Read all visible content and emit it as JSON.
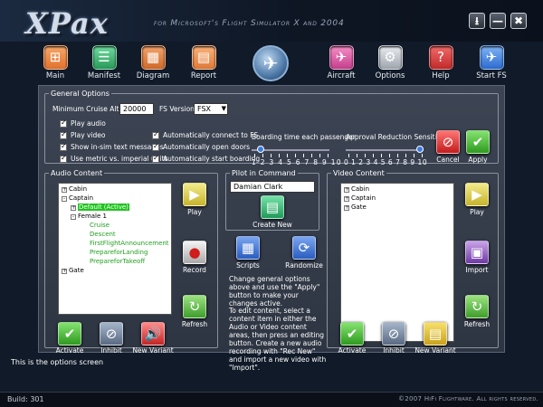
{
  "app": {
    "logo": "XPax",
    "subtitle": "for Microsoft's Flight Simulator X and 2004"
  },
  "window_controls": {
    "download": "⭳",
    "minimize": "—",
    "close": "✖"
  },
  "toolbar": {
    "main": "Main",
    "manifest": "Manifest",
    "diagram": "Diagram",
    "report": "Report",
    "aircraft": "Aircraft",
    "options": "Options",
    "help": "Help",
    "start_fs": "Start FS"
  },
  "general_options": {
    "legend": "General Options",
    "min_cruise_label": "Minimum Cruise Altitude",
    "min_cruise_value": "20000",
    "fs_version_label": "FS Version",
    "fs_version_value": "FSX",
    "checks": [
      "Play audio",
      "Play video",
      "Show in-sim text messages",
      "Use metric vs. imperial units"
    ],
    "checks2": [
      "Automatically connect to FS",
      "Automatically open doors",
      "Automatically start boarding"
    ],
    "boarding_label": "Boarding time each passenger",
    "boarding_value": 2,
    "approval_label": "Approval Reduction Sensitivity",
    "approval_value": 10,
    "scale": "1 2 3 4 5 6 7 8 9 10",
    "scale0": "0 1 2 3 4 5 6 7 8 9 10",
    "cancel": "Cancel",
    "apply": "Apply"
  },
  "audio": {
    "legend": "Audio Content",
    "tree": {
      "cabin": "Cabin",
      "captain": "Captain",
      "default": "Default (Active)",
      "female": "Female 1",
      "items": [
        "Cruise",
        "Descent",
        "FirstFlightAnnouncement",
        "PrepareforLanding",
        "PrepareforTakeoff"
      ],
      "gate": "Gate"
    },
    "play": "Play",
    "record": "Record",
    "refresh": "Refresh",
    "activate": "Activate",
    "inhibit": "Inhibit",
    "new_variant": "New Variant"
  },
  "pilot": {
    "legend": "Pilot in Command",
    "name": "Damian Clark",
    "create_new": "Create New",
    "scripts": "Scripts",
    "randomize": "Randomize",
    "help1": "Change general options above and use the \"Apply\" button to make your changes active.",
    "help2": "To edit content, select a content item in either the Audio or Video content areas, then press an editing button.  Create a new audio recording with \"Rec New\" and import a new video with \"Import\"."
  },
  "video": {
    "legend": "Video Content",
    "tree": {
      "cabin": "Cabin",
      "captain": "Captain",
      "gate": "Gate"
    },
    "play": "Play",
    "import": "Import",
    "refresh": "Refresh",
    "activate": "Activate",
    "inhibit": "Inhibit",
    "new_variant": "New Variant"
  },
  "status_text": "This is the options screen",
  "build": "Build: 301",
  "copyright": "©2007 HiFi Flightware. All rights reserved.",
  "colors": {
    "accent": "#3a7be0",
    "highlight_green": "#1fc41f",
    "panel": "#343b49"
  }
}
